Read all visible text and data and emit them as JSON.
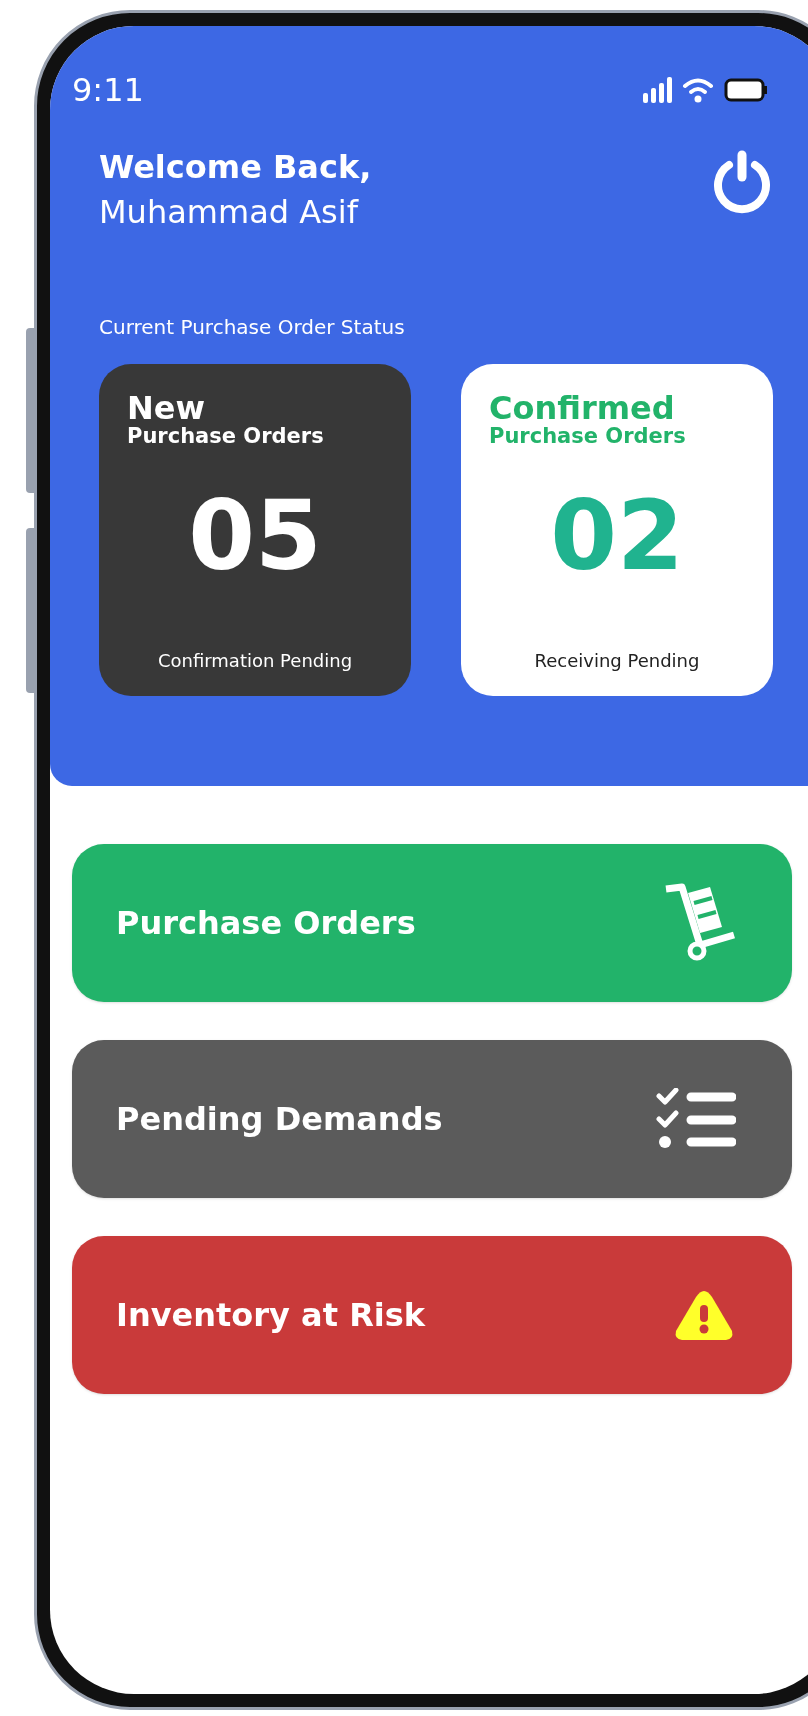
{
  "status_bar": {
    "time": "9:11"
  },
  "header": {
    "greeting": "Welcome Back,",
    "user_name": "Muhammad Asif"
  },
  "section_title": "Current Purchase Order Status",
  "status_cards": [
    {
      "kind": "dark",
      "title": "New",
      "subtitle": "Purchase Orders",
      "count": "05",
      "caption": "Confirmation Pending"
    },
    {
      "kind": "light",
      "title": "Confirmed",
      "subtitle": "Purchase Orders",
      "count": "02",
      "caption": "Receiving Pending"
    }
  ],
  "menu": [
    {
      "kind": "orders",
      "label": "Purchase Orders"
    },
    {
      "kind": "demands",
      "label": "Pending Demands"
    },
    {
      "kind": "risk",
      "label": "Inventory at Risk"
    }
  ]
}
